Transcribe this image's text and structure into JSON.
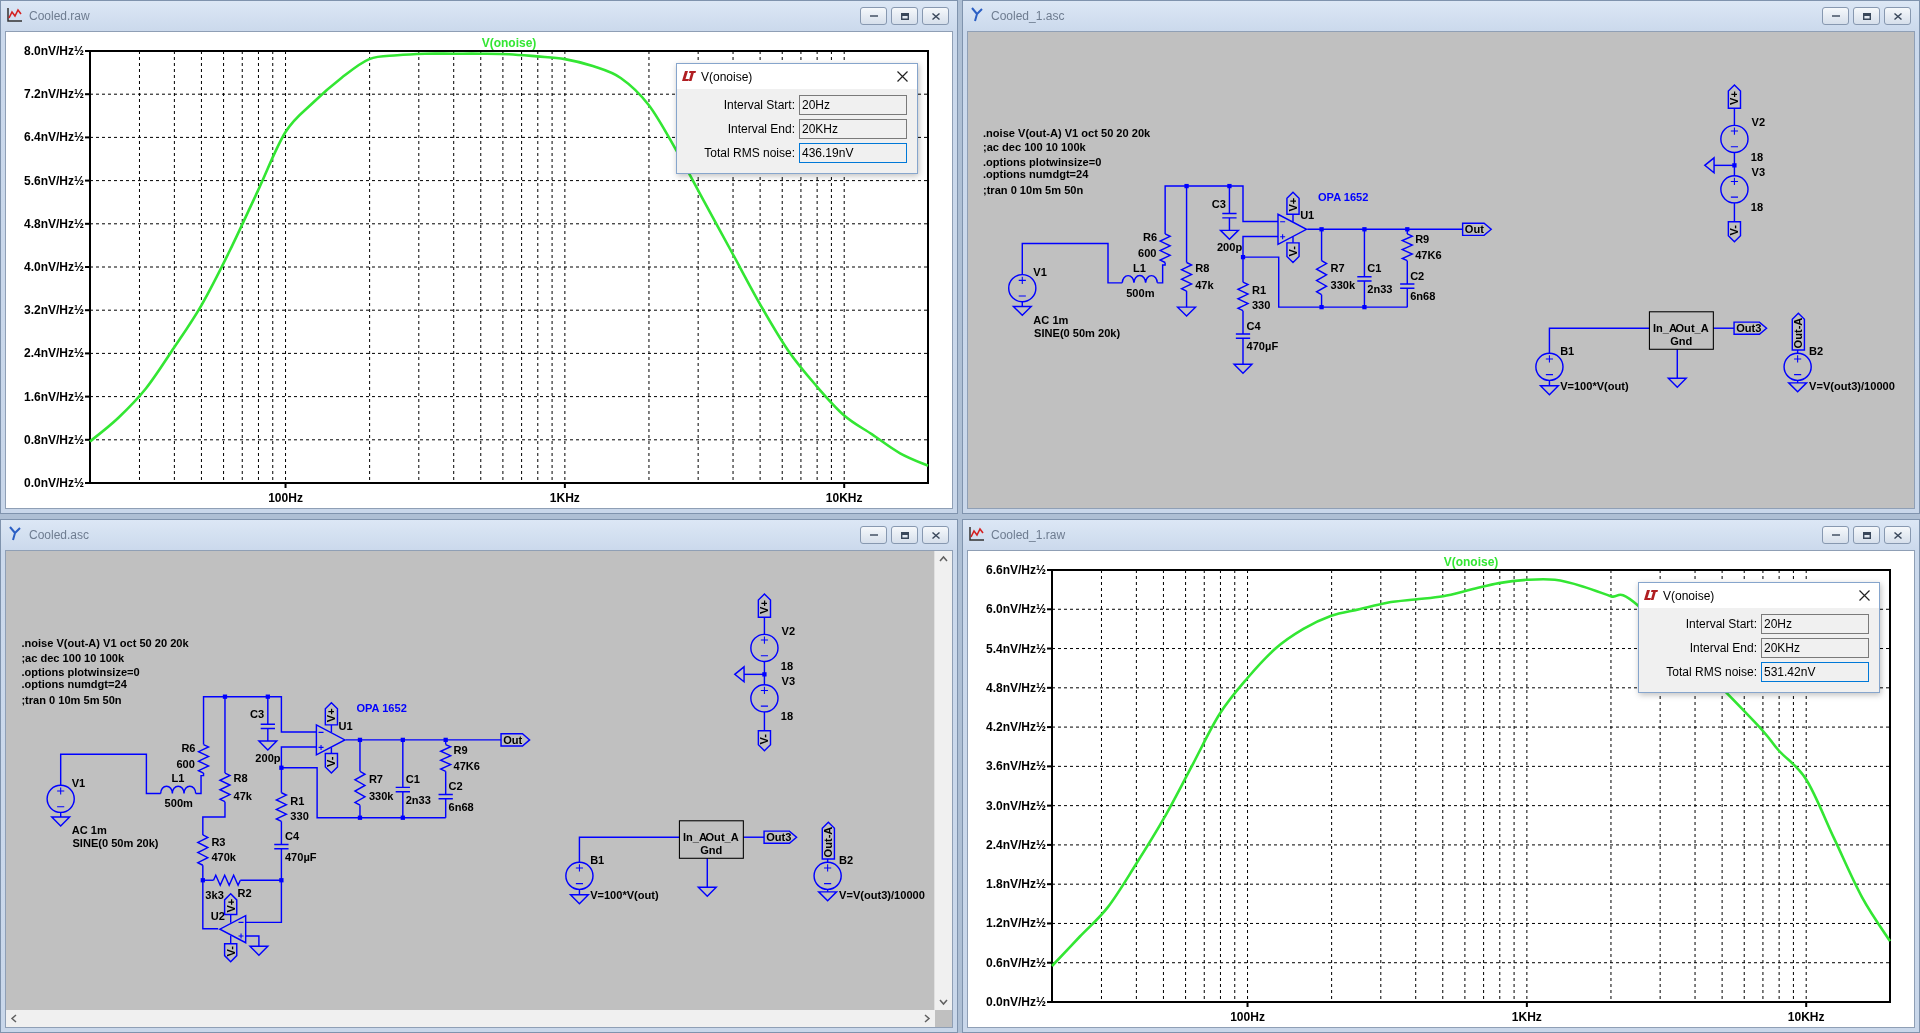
{
  "windows": [
    {
      "kind": "plot",
      "title": "Cooled.raw",
      "chart_data": {
        "type": "line",
        "categories": [
          null,
          null,
          null,
          null,
          null,
          null,
          null,
          "100Hz",
          null,
          null,
          null,
          null,
          null,
          null,
          null,
          null,
          null,
          "1KHz",
          null,
          null,
          null,
          null,
          null,
          null,
          null,
          null,
          null,
          "10KHz",
          null,
          null,
          null
        ],
        "series": [
          {
            "name": "V(onoise)",
            "color": "#33e633",
            "values": [
              0.77,
              1.2,
              1.75,
              2.5,
              3.3,
              4.3,
              5.4,
              6.5,
              7.05,
              7.5,
              7.85,
              7.92,
              7.95,
              7.95,
              7.95,
              7.94,
              7.9,
              7.85,
              7.72,
              7.5,
              7.0,
              6.15,
              5.2,
              4.25,
              3.3,
              2.45,
              1.8,
              1.25,
              0.9,
              0.55,
              0.32
            ]
          }
        ],
        "ylim": [
          0,
          8
        ],
        "grid": true,
        "yticks": [
          {
            "value": 0,
            "label": "0.0nV/Hz½"
          },
          {
            "value": 0.8,
            "label": "0.8nV/Hz½"
          },
          {
            "value": 1.6,
            "label": "1.6nV/Hz½"
          },
          {
            "value": 2.4,
            "label": "2.4nV/Hz½"
          },
          {
            "value": 3.2,
            "label": "3.2nV/Hz½"
          },
          {
            "value": 4,
            "label": "4.0nV/Hz½"
          },
          {
            "value": 4.8,
            "label": "4.8nV/Hz½"
          },
          {
            "value": 5.6,
            "label": "5.6nV/Hz½"
          },
          {
            "value": 6.4,
            "label": "6.4nV/Hz½"
          },
          {
            "value": 7.2,
            "label": "7.2nV/Hz½"
          },
          {
            "value": 8,
            "label": "8.0nV/Hz½"
          }
        ]
      },
      "dialog": {
        "title": "V(onoise)",
        "fields": [
          {
            "label": "Interval Start:",
            "value": "20Hz",
            "focused": false
          },
          {
            "label": "Interval End:",
            "value": "20KHz",
            "focused": false
          },
          {
            "label": "Total RMS noise:",
            "value": "436.19nV",
            "focused": true
          }
        ]
      }
    },
    {
      "kind": "schematic",
      "title": "Cooled_1.asc",
      "directives": [
        ".noise V(out-A) V1 oct 50 20 20k",
        ";ac dec 100 10 100k",
        ".options plotwinsize=0",
        ".options numdgt=24",
        ";tran 0 10m 5m 50n"
      ],
      "parts": [
        {
          "kind": "source",
          "ref": "V1",
          "values": [
            "AC 1m",
            "SINE(0 50m 20k)"
          ]
        },
        {
          "kind": "resistor",
          "ref": "R6",
          "values": [
            "600"
          ]
        },
        {
          "kind": "inductor",
          "ref": "L1",
          "values": [
            "500m"
          ]
        },
        {
          "kind": "resistor",
          "ref": "R8",
          "values": [
            "47k"
          ]
        },
        {
          "kind": "capacitor",
          "ref": "C3",
          "values": [
            "200p"
          ]
        },
        {
          "kind": "opamp",
          "ref": "U1",
          "values": [
            "OPA 1652"
          ]
        },
        {
          "kind": "resistor",
          "ref": "R1",
          "values": [
            "330"
          ]
        },
        {
          "kind": "capacitor",
          "ref": "C4",
          "values": [
            "470µF"
          ]
        },
        {
          "kind": "resistor",
          "ref": "R7",
          "values": [
            "330k"
          ]
        },
        {
          "kind": "capacitor",
          "ref": "C1",
          "values": [
            "2n33"
          ]
        },
        {
          "kind": "resistor",
          "ref": "R9",
          "values": [
            "47K6"
          ]
        },
        {
          "kind": "capacitor",
          "ref": "C2",
          "values": [
            "6n68"
          ]
        },
        {
          "kind": "source",
          "ref": "V2",
          "values": [
            "18"
          ]
        },
        {
          "kind": "source",
          "ref": "V3",
          "values": [
            "18"
          ]
        },
        {
          "kind": "source",
          "ref": "B1",
          "values": [
            "V=100*V(out)"
          ]
        },
        {
          "kind": "source",
          "ref": "B2",
          "values": [
            "V=V(out3)/10000"
          ]
        },
        {
          "kind": "block",
          "values": [
            "In_A",
            "Out_A",
            "Gnd"
          ]
        }
      ],
      "flags": [
        {
          "label": "Out"
        },
        {
          "label": "V+"
        },
        {
          "label": "V-"
        },
        {
          "label": "V+"
        },
        {
          "label": "V-"
        },
        {
          "label": "Out3"
        },
        {
          "label": "Out-A"
        }
      ]
    },
    {
      "kind": "schematic",
      "title": "Cooled.asc",
      "scrollbars": true,
      "directives": [
        ".noise V(out-A) V1 oct 50 20 20k",
        ";ac dec 100 10 100k",
        ".options plotwinsize=0",
        ".options numdgt=24",
        ";tran 0 10m 5m 50n"
      ],
      "parts": [
        {
          "kind": "source",
          "ref": "V1",
          "values": [
            "AC 1m",
            "SINE(0 50m 20k)"
          ]
        },
        {
          "kind": "resistor",
          "ref": "R6",
          "values": [
            "600"
          ]
        },
        {
          "kind": "inductor",
          "ref": "L1",
          "values": [
            "500m"
          ]
        },
        {
          "kind": "resistor",
          "ref": "R8",
          "values": [
            "47k"
          ]
        },
        {
          "kind": "capacitor",
          "ref": "C3",
          "values": [
            "200p"
          ]
        },
        {
          "kind": "opamp",
          "ref": "U1",
          "values": [
            "OPA 1652"
          ]
        },
        {
          "kind": "resistor",
          "ref": "R1",
          "values": [
            "330"
          ]
        },
        {
          "kind": "capacitor",
          "ref": "C4",
          "values": [
            "470µF"
          ]
        },
        {
          "kind": "resistor",
          "ref": "R7",
          "values": [
            "330k"
          ]
        },
        {
          "kind": "capacitor",
          "ref": "C1",
          "values": [
            "2n33"
          ]
        },
        {
          "kind": "resistor",
          "ref": "R9",
          "values": [
            "47K6"
          ]
        },
        {
          "kind": "capacitor",
          "ref": "C2",
          "values": [
            "6n68"
          ]
        },
        {
          "kind": "source",
          "ref": "V2",
          "values": [
            "18"
          ]
        },
        {
          "kind": "source",
          "ref": "V3",
          "values": [
            "18"
          ]
        },
        {
          "kind": "source",
          "ref": "B1",
          "values": [
            "V=100*V(out)"
          ]
        },
        {
          "kind": "source",
          "ref": "B2",
          "values": [
            "V=V(out3)/10000"
          ]
        },
        {
          "kind": "resistor",
          "ref": "R3",
          "values": [
            "470k"
          ]
        },
        {
          "kind": "resistor",
          "ref": "R2",
          "values": [
            "3k3"
          ]
        },
        {
          "kind": "opamp",
          "ref": "U2"
        },
        {
          "kind": "block",
          "values": [
            "In_A",
            "Out_A",
            "Gnd"
          ]
        }
      ],
      "flags": [
        {
          "label": "Out"
        },
        {
          "label": "V+"
        },
        {
          "label": "V-"
        },
        {
          "label": "V+"
        },
        {
          "label": "V-"
        },
        {
          "label": "Out3"
        },
        {
          "label": "Out-A"
        },
        {
          "label": "V+"
        },
        {
          "label": "V-"
        }
      ]
    },
    {
      "kind": "plot",
      "title": "Cooled_1.raw",
      "chart_data": {
        "type": "line",
        "categories": [
          null,
          null,
          null,
          null,
          null,
          null,
          null,
          "100Hz",
          null,
          null,
          null,
          null,
          null,
          null,
          null,
          null,
          null,
          "1KHz",
          null,
          null,
          null,
          null,
          null,
          null,
          null,
          null,
          null,
          "10KHz",
          null,
          null,
          null
        ],
        "series": [
          {
            "name": "V(onoise)",
            "color": "#33e633",
            "values": [
              0.55,
              1.0,
              1.45,
              2.1,
              2.8,
              3.6,
              4.4,
              4.95,
              5.4,
              5.7,
              5.9,
              6.0,
              6.1,
              6.15,
              6.2,
              6.3,
              6.4,
              6.45,
              6.45,
              6.35,
              6.2,
              6.05,
              null,
              null,
              null,
              4.35,
              3.85,
              3.4,
              2.5,
              1.6,
              0.93
            ]
          }
        ],
        "ylim": [
          0,
          6.6
        ],
        "grid": true,
        "yticks": [
          {
            "value": 0,
            "label": "0.0nV/Hz½"
          },
          {
            "value": 0.6,
            "label": "0.6nV/Hz½"
          },
          {
            "value": 1.2,
            "label": "1.2nV/Hz½"
          },
          {
            "value": 1.8,
            "label": "1.8nV/Hz½"
          },
          {
            "value": 2.4,
            "label": "2.4nV/Hz½"
          },
          {
            "value": 3,
            "label": "3.0nV/Hz½"
          },
          {
            "value": 3.6,
            "label": "3.6nV/Hz½"
          },
          {
            "value": 4.2,
            "label": "4.2nV/Hz½"
          },
          {
            "value": 4.8,
            "label": "4.8nV/Hz½"
          },
          {
            "value": 5.4,
            "label": "5.4nV/Hz½"
          },
          {
            "value": 6,
            "label": "6.0nV/Hz½"
          },
          {
            "value": 6.6,
            "label": "6.6nV/Hz½"
          }
        ]
      },
      "dialog": {
        "title": "V(onoise)",
        "fields": [
          {
            "label": "Interval Start:",
            "value": "20Hz",
            "focused": false
          },
          {
            "label": "Interval End:",
            "value": "20KHz",
            "focused": false
          },
          {
            "label": "Total RMS noise:",
            "value": "531.42nV",
            "focused": true
          }
        ]
      }
    }
  ]
}
